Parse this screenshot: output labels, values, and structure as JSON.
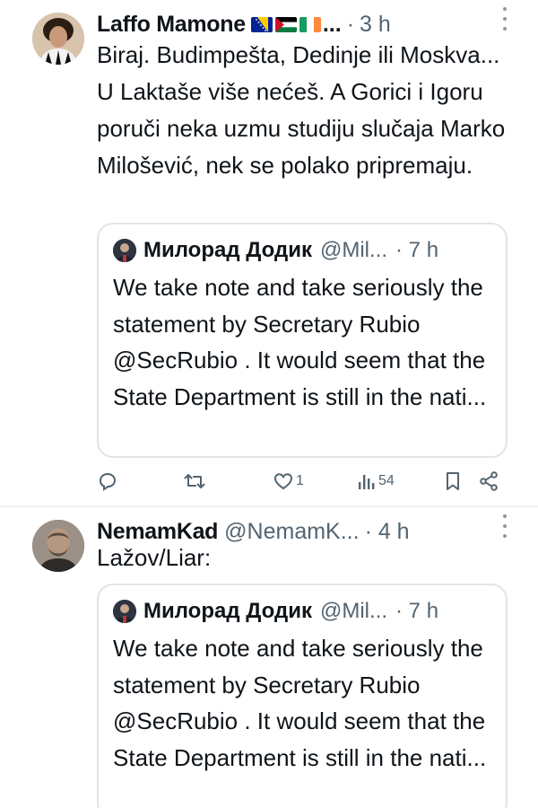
{
  "tweets": [
    {
      "author": {
        "name": "Laffo Mamone",
        "ellipsis": "...",
        "time_sep": "·",
        "time": "3 h"
      },
      "text": "Biraj. Budimpešta, Dedinje ili Moskva... U Laktaše više nećeš. A Gorici i Igoru poruči neka uzmu studiju slučaja Marko Milošević, nek se polako pripremaju.",
      "quote": {
        "name": "Милорад Додик",
        "handle": "@Mil...",
        "time": "· 7 h",
        "text": "We take note and take seriously the statement by Secretary Rubio @SecRubio . It would seem that the State Department is still in the nati..."
      },
      "actions": {
        "reply_icon": "reply-icon",
        "retweet_icon": "retweet-icon",
        "like_icon": "heart-icon",
        "likes": "1",
        "views_icon": "views-icon",
        "views": "54",
        "bookmark_icon": "bookmark-icon",
        "share_icon": "share-icon"
      }
    },
    {
      "author": {
        "name": "NemamKad",
        "handle": "@NemamK...",
        "time": "· 4 h"
      },
      "text": "Lažov/Liar:",
      "quote": {
        "name": "Милорад Додик",
        "handle": "@Mil...",
        "time": "· 7 h",
        "text": "We take note and take seriously the statement by Secretary Rubio @SecRubio . It would seem that the State Department is still in the nati..."
      }
    }
  ],
  "colors": {
    "text": "#0f1419",
    "secondary": "#536471",
    "border": "#dfe5e8"
  }
}
